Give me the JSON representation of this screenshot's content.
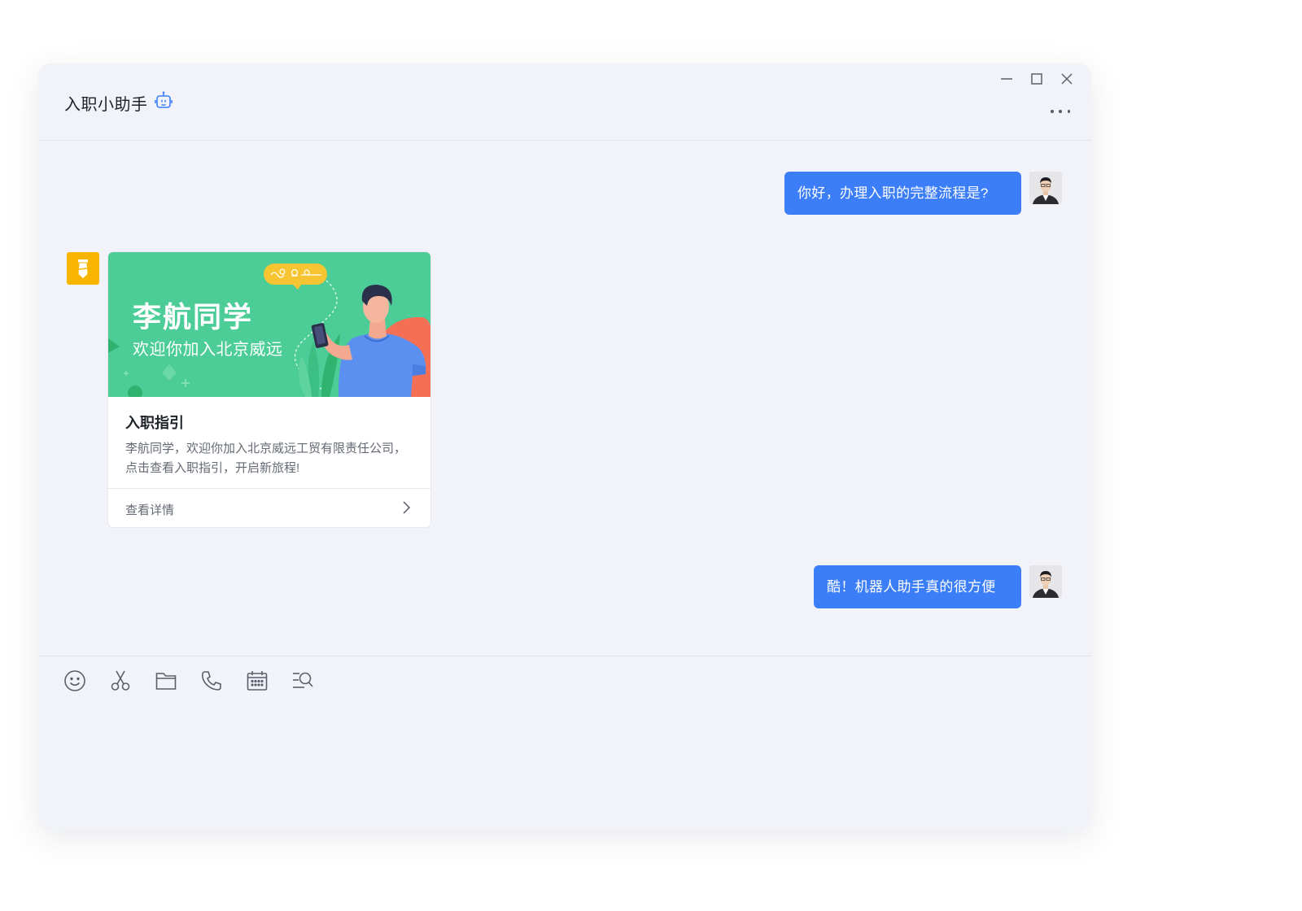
{
  "window": {
    "title": "入职小助手",
    "controls": [
      "minimize-icon",
      "maximize-icon",
      "close-icon"
    ],
    "more_icon": "more-horizontal-icon"
  },
  "colors": {
    "window_bg": "#f1f3f8",
    "bubble_blue": "#3b7ef8",
    "banner_green": "#4ccd97",
    "bot_avatar_yellow": "#f7b500",
    "tshirt_blue": "#5b8ff0",
    "accent_orange": "#f56f54"
  },
  "messages": [
    {
      "from": "user",
      "text": "你好，办理入职的完整流程是?"
    },
    {
      "from": "bot",
      "card": {
        "banner_title": "李航同学",
        "banner_subtitle": "欢迎你加入北京威远",
        "title": "入职指引",
        "description": "李航同学，欢迎你加入北京威远工贸有限责任公司，点击查看入职指引，开启新旅程!",
        "action_label": "查看详情"
      }
    },
    {
      "from": "user",
      "text": "酷！机器人助手真的很方便"
    }
  ],
  "toolbar": {
    "icons": [
      "emoji-icon",
      "scissors-icon",
      "folder-icon",
      "phone-icon",
      "calendar-icon",
      "search-list-icon"
    ]
  }
}
